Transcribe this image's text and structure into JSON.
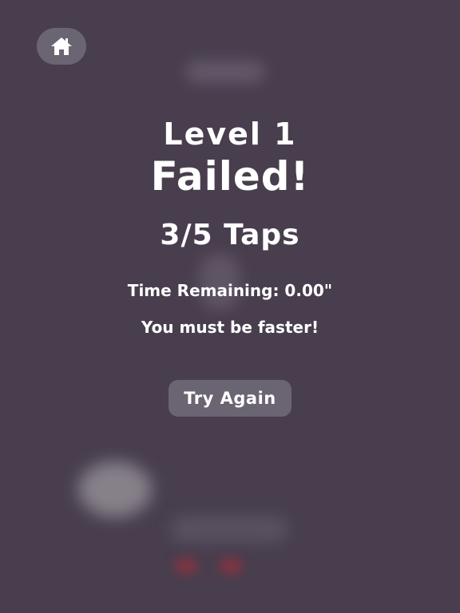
{
  "colors": {
    "background": "#483e4e",
    "button": "#6b6472",
    "text": "#ffffff"
  },
  "home": {
    "icon": "home-icon"
  },
  "result": {
    "level": "Level 1",
    "status": "Failed!",
    "taps": "3/5 Taps",
    "time_remaining": "Time Remaining: 0.00\"",
    "hint": "You must be faster!"
  },
  "actions": {
    "try_again_label": "Try Again"
  }
}
